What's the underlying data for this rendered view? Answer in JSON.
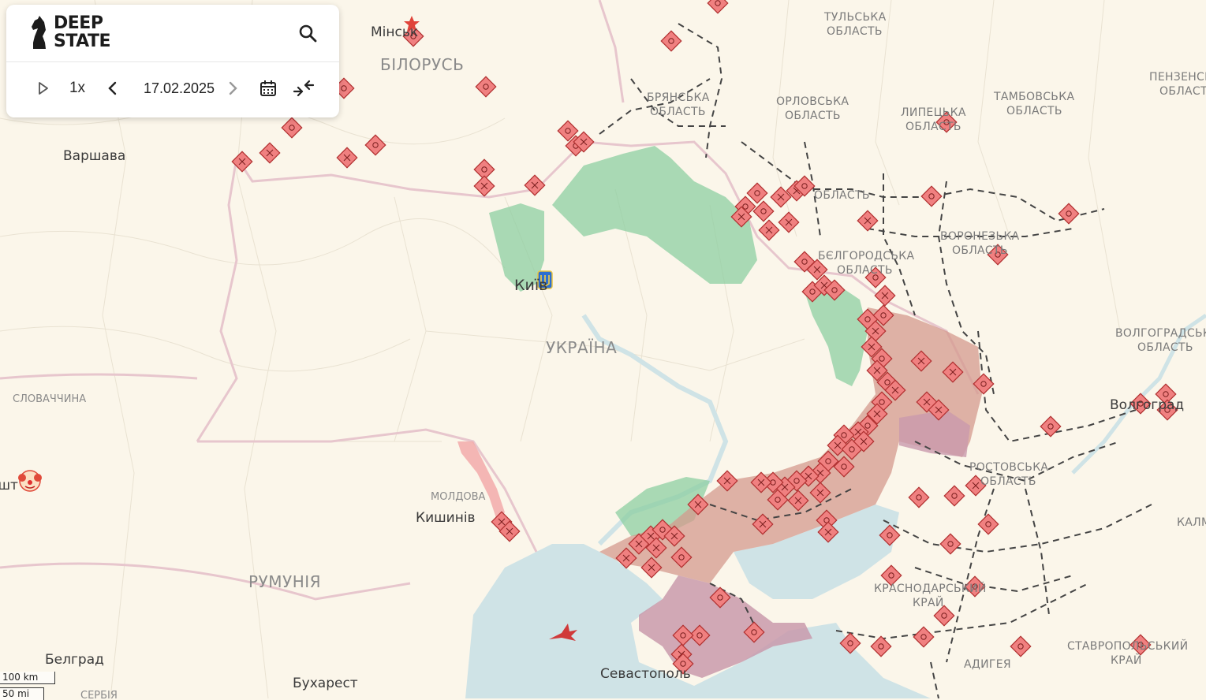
{
  "app": {
    "logo_line1": "DEEP",
    "logo_line2": "STATE"
  },
  "controls": {
    "speed": "1x",
    "date": "17.02.2025"
  },
  "colors": {
    "land": "#fbf6ea",
    "sea": "#cfe3e6",
    "occupied": "#d49a8e",
    "occupied_pre2022": "#c99aac",
    "liberated": "#8ecfa2",
    "contested": "#f2a6a6",
    "marker_fill": "#f08080",
    "marker_stroke": "#b03030",
    "border": "#e7c6cd"
  },
  "labels": {
    "countries": [
      {
        "id": "belarus",
        "text": "БІЛОРУСЬ"
      },
      {
        "id": "ukraine",
        "text": "УКРАЇНА"
      },
      {
        "id": "romania",
        "text": "РУМУНІЯ"
      }
    ],
    "cities": [
      {
        "id": "minsk",
        "text": "Мінськ"
      },
      {
        "id": "warsaw",
        "text": "Варшава"
      },
      {
        "id": "kyiv",
        "text": "Київ"
      },
      {
        "id": "chisinau",
        "text": "Кишинів"
      },
      {
        "id": "sevastopol",
        "text": "Севастополь"
      },
      {
        "id": "belgrade",
        "text": "Белград"
      },
      {
        "id": "bucharest",
        "text": "Бухарест"
      },
      {
        "id": "volgograd",
        "text": "Волгоград"
      },
      {
        "id": "budapest",
        "text": "Будапешт"
      }
    ],
    "regions": [
      {
        "id": "tula",
        "line1": "ТУЛЬСЬКА",
        "line2": "ОБЛАСТЬ"
      },
      {
        "id": "bryansk",
        "line1": "БРЯНСЬКА",
        "line2": "ОБЛАСТЬ"
      },
      {
        "id": "orel",
        "line1": "ОРЛОВСЬКА",
        "line2": "ОБЛАСТЬ"
      },
      {
        "id": "lipetsk",
        "line1": "ЛИПЕЦЬКА",
        "line2": "ОБЛАСТЬ"
      },
      {
        "id": "tambov",
        "line1": "ТАМБОВСЬКА",
        "line2": "ОБЛАСТЬ"
      },
      {
        "id": "penza",
        "line1": "ПЕНЗЕНСЬКА",
        "line2": "ОБЛАСТЬ"
      },
      {
        "id": "kursk",
        "line1": "ОБЛАСТЬ",
        "line2": ""
      },
      {
        "id": "voronezh",
        "line1": "ВОРОНЕЗЬКА",
        "line2": "ОБЛАСТЬ"
      },
      {
        "id": "belgorod",
        "line1": "БЄЛГОРОДСЬКА",
        "line2": "ОБЛАСТЬ"
      },
      {
        "id": "volgograd_obl",
        "line1": "ВОЛГОГРАДСЬКА",
        "line2": "ОБЛАСТЬ"
      },
      {
        "id": "rostov",
        "line1": "РОСТОВСЬКА",
        "line2": "ОБЛАСТЬ"
      },
      {
        "id": "krasnodar",
        "line1": "КРАСНОДАРСЬКИЙ",
        "line2": "КРАЙ"
      },
      {
        "id": "stavropol",
        "line1": "СТАВРОПОЛЬСЬКИЙ",
        "line2": "КРАЙ"
      },
      {
        "id": "kalmykia",
        "line1": "КАЛМ",
        "line2": ""
      },
      {
        "id": "adygea",
        "line1": "АДИГЕЯ",
        "line2": ""
      },
      {
        "id": "slovakia",
        "line1": "СЛОВАЧЧИНА",
        "line2": ""
      },
      {
        "id": "moldova",
        "line1": "МОЛДОВА",
        "line2": ""
      },
      {
        "id": "serbia",
        "line1": "СЕРБІЯ",
        "line2": ""
      }
    ]
  },
  "scale": {
    "km": "100 km",
    "mi": "50 mi"
  }
}
